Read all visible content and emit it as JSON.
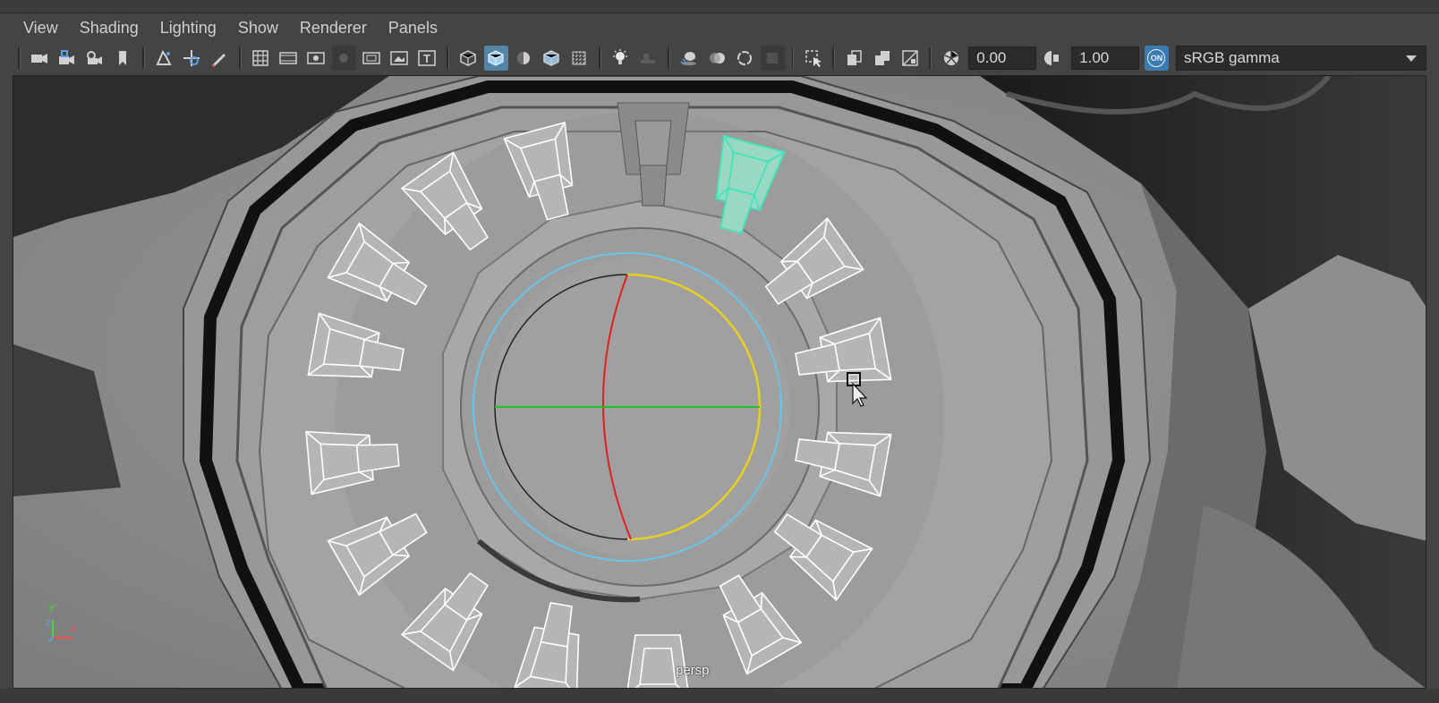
{
  "menubar": {
    "items": [
      "View",
      "Shading",
      "Lighting",
      "Show",
      "Renderer",
      "Panels"
    ]
  },
  "toolbar": {
    "icons": [
      "select-camera-icon",
      "lock-camera-icon",
      "camera-attributes-icon",
      "bookmark-icon",
      "image-plane-icon",
      "2d-pan-zoom-icon",
      "grease-pencil-icon",
      "grid-icon",
      "film-gate-icon",
      "resolution-gate-icon",
      "gate-mask-icon",
      "field-chart-icon",
      "safe-action-icon",
      "safe-title-icon",
      "wireframe-icon",
      "smooth-shade-icon",
      "default-material-icon",
      "wireframe-on-shaded-icon",
      "xray-icon",
      "use-all-lights-icon",
      "shadows-icon",
      "screen-space-ao-icon",
      "motion-blur-icon",
      "multisample-aa-icon",
      "depth-of-field-icon",
      "isolate-select-icon",
      "xray-joints-icon",
      "xray-active-components-icon",
      "textures-icon",
      "exposure-icon",
      "gamma-icon",
      "color-management-icon"
    ],
    "exposure_value": "0.00",
    "gamma_value": "1.00",
    "color_management_badge": "ON",
    "color_space": "sRGB gamma"
  },
  "viewport": {
    "camera_name": "persp",
    "axis_labels": {
      "x": "x",
      "y": "y",
      "z": "z"
    },
    "colors": {
      "selected_wire": "#3fe6b8",
      "rotate_x": "#e02020",
      "rotate_y": "#22c022",
      "rotate_z": "#e8d020",
      "rotate_view": "#6ac4e8"
    }
  }
}
